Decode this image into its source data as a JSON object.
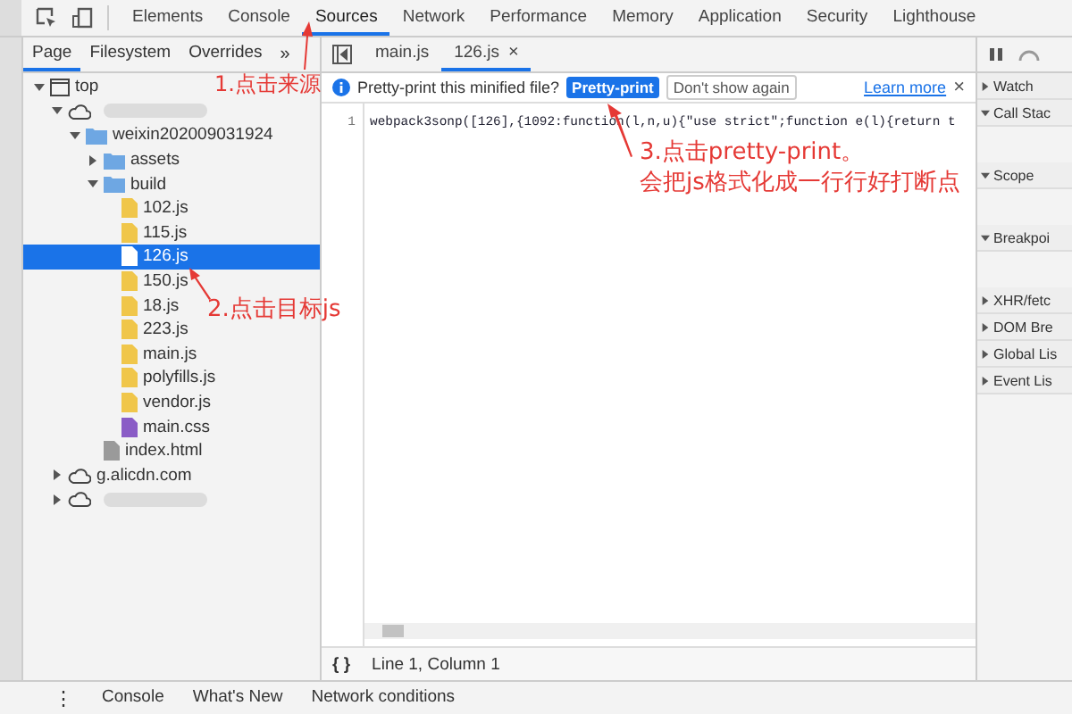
{
  "main_tabs": [
    {
      "label": "Elements",
      "selected": false
    },
    {
      "label": "Console",
      "selected": false
    },
    {
      "label": "Sources",
      "selected": true
    },
    {
      "label": "Network",
      "selected": false
    },
    {
      "label": "Performance",
      "selected": false
    },
    {
      "label": "Memory",
      "selected": false
    },
    {
      "label": "Application",
      "selected": false
    },
    {
      "label": "Security",
      "selected": false
    },
    {
      "label": "Lighthouse",
      "selected": false
    }
  ],
  "navigator": {
    "tabs": [
      {
        "label": "Page",
        "selected": true
      },
      {
        "label": "Filesystem",
        "selected": false
      },
      {
        "label": "Overrides",
        "selected": false
      }
    ],
    "more": "»",
    "tree": [
      {
        "kind": "frame",
        "label": "top",
        "expanded": true,
        "selected": false,
        "children": [
          {
            "kind": "domain",
            "blurred": true,
            "expanded": true,
            "selected": false,
            "children": [
              {
                "kind": "folder",
                "label": "weixin202009031924",
                "expanded": true,
                "selected": false,
                "children": [
                  {
                    "kind": "folder",
                    "label": "assets",
                    "expanded": false,
                    "selected": false
                  },
                  {
                    "kind": "folder",
                    "label": "build",
                    "expanded": true,
                    "selected": false,
                    "children": [
                      {
                        "kind": "js",
                        "label": "102.js",
                        "selected": false
                      },
                      {
                        "kind": "js",
                        "label": "115.js",
                        "selected": false
                      },
                      {
                        "kind": "js",
                        "label": "126.js",
                        "selected": true
                      },
                      {
                        "kind": "js",
                        "label": "150.js",
                        "selected": false
                      },
                      {
                        "kind": "js",
                        "label": "18.js",
                        "selected": false
                      },
                      {
                        "kind": "js",
                        "label": "223.js",
                        "selected": false
                      },
                      {
                        "kind": "js",
                        "label": "main.js",
                        "selected": false
                      },
                      {
                        "kind": "js",
                        "label": "polyfills.js",
                        "selected": false
                      },
                      {
                        "kind": "js",
                        "label": "vendor.js",
                        "selected": false
                      },
                      {
                        "kind": "css",
                        "label": "main.css",
                        "selected": false
                      }
                    ]
                  },
                  {
                    "kind": "html",
                    "label": "index.html",
                    "selected": false
                  }
                ]
              }
            ]
          },
          {
            "kind": "domain",
            "label": "g.alicdn.com",
            "expanded": false,
            "selected": false
          },
          {
            "kind": "domain",
            "blurred": true,
            "expanded": false,
            "selected": false
          }
        ]
      }
    ]
  },
  "editor": {
    "tabs": [
      {
        "label": "main.js",
        "selected": false
      },
      {
        "label": "126.js",
        "selected": true,
        "close": "×"
      }
    ],
    "infobar": {
      "message": "Pretty-print this minified file?",
      "primary_button": "Pretty-print",
      "secondary_button": "Don't show again",
      "link": "Learn more",
      "close": "×"
    },
    "lines": [
      {
        "number": "1",
        "code": "webpack3sonp([126],{1092:function(l,n,u){\"use strict\";function e(l){return t"
      }
    ],
    "format_button": "{ }",
    "cursor": "Line 1, Column 1"
  },
  "debugger": {
    "sections": [
      {
        "label": "Watch",
        "expanded": false
      },
      {
        "label": "Call Stac",
        "expanded": true
      },
      {
        "label": "Scope",
        "expanded": true
      },
      {
        "label": "Breakpoi",
        "expanded": true
      },
      {
        "label": "XHR/fetc",
        "expanded": false
      },
      {
        "label": "DOM Bre",
        "expanded": false
      },
      {
        "label": "Global Lis",
        "expanded": false
      },
      {
        "label": "Event Lis",
        "expanded": false
      }
    ]
  },
  "drawer": {
    "menu": "⋮",
    "tabs": [
      {
        "label": "Console",
        "selected": false
      },
      {
        "label": "What's New",
        "selected": false
      },
      {
        "label": "Network conditions",
        "selected": false
      }
    ]
  },
  "annotations": [
    {
      "lines": [
        "1.点击来源"
      ]
    },
    {
      "lines": [
        "2.点击目标js"
      ]
    },
    {
      "lines": [
        "3.点击pretty-print。",
        "会把js格式化成一行行好打断点"
      ]
    }
  ]
}
